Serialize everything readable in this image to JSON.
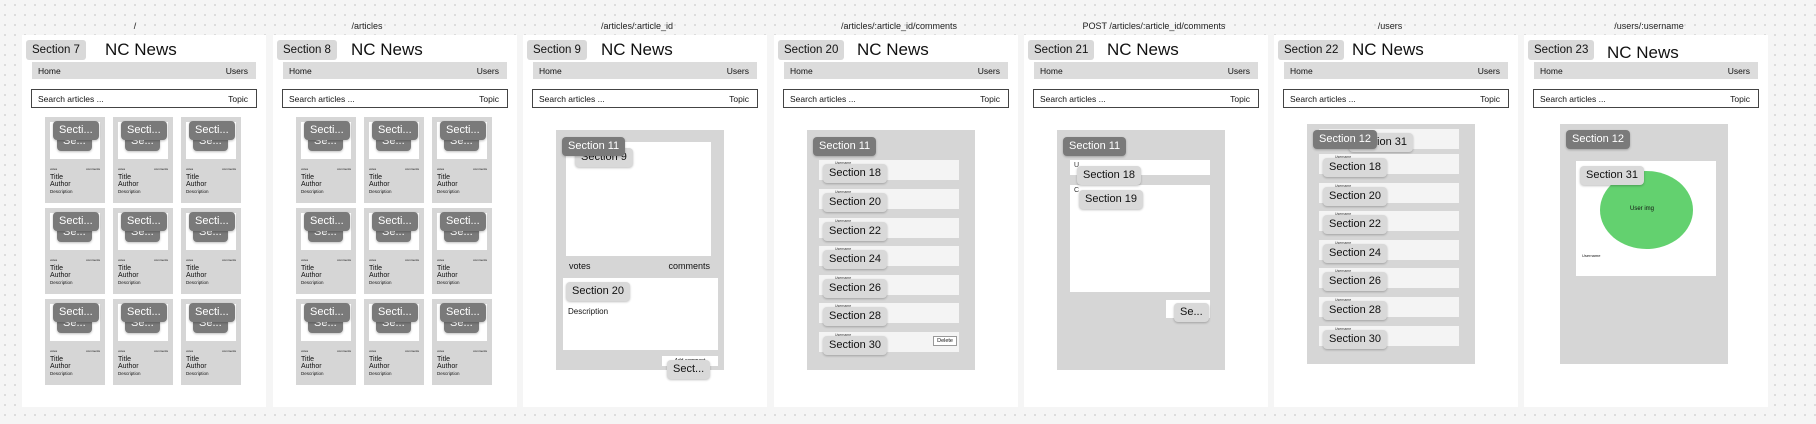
{
  "routes": [
    "/",
    "/articles",
    "/articles/:article_id",
    "/articles/:article_id/comments",
    "POST /articles/:article_id/comments",
    "/users",
    "/users/:username"
  ],
  "frames": [
    "Section 7",
    "Section 8",
    "Section 9",
    "Section 20",
    "Section 21",
    "Section 22",
    "Section 23"
  ],
  "brand": "NC News",
  "nav": {
    "home": "Home",
    "users": "Users"
  },
  "search": {
    "placeholder": "Search articles ...",
    "topic": "Topic"
  },
  "card": {
    "section": "Secti...",
    "inner": "Se...",
    "votes": "votes",
    "comments": "comments",
    "title": "Title",
    "author": "Author",
    "description": "Description"
  },
  "article": {
    "panel": "Section 11",
    "image_section": "Section 9",
    "votes": "votes",
    "comments": "comments",
    "body_section": "Section 20",
    "description": "Description",
    "add_comment": "Add comment",
    "footer": "Sect..."
  },
  "comments": {
    "panel": "Section 11",
    "rows": [
      "Section 18",
      "Section 20",
      "Section 22",
      "Section 24",
      "Section 26",
      "Section 28",
      "Section 30"
    ],
    "username": "Username",
    "delete": "Delete"
  },
  "post": {
    "panel": "Section 11",
    "s18": "Section 18",
    "s19": "Section 19",
    "submit": "Se...",
    "frag_u": "U",
    "frag_c": "C"
  },
  "users": {
    "panel": "Section 12",
    "first_row": "Section 31",
    "rows": [
      "Section 18",
      "Section 20",
      "Section 22",
      "Section 24",
      "Section 26",
      "Section 28",
      "Section 30"
    ],
    "username": "Username"
  },
  "profile": {
    "panel": "Section 12",
    "card": "Section 31",
    "img": "User img",
    "username": "Username"
  }
}
